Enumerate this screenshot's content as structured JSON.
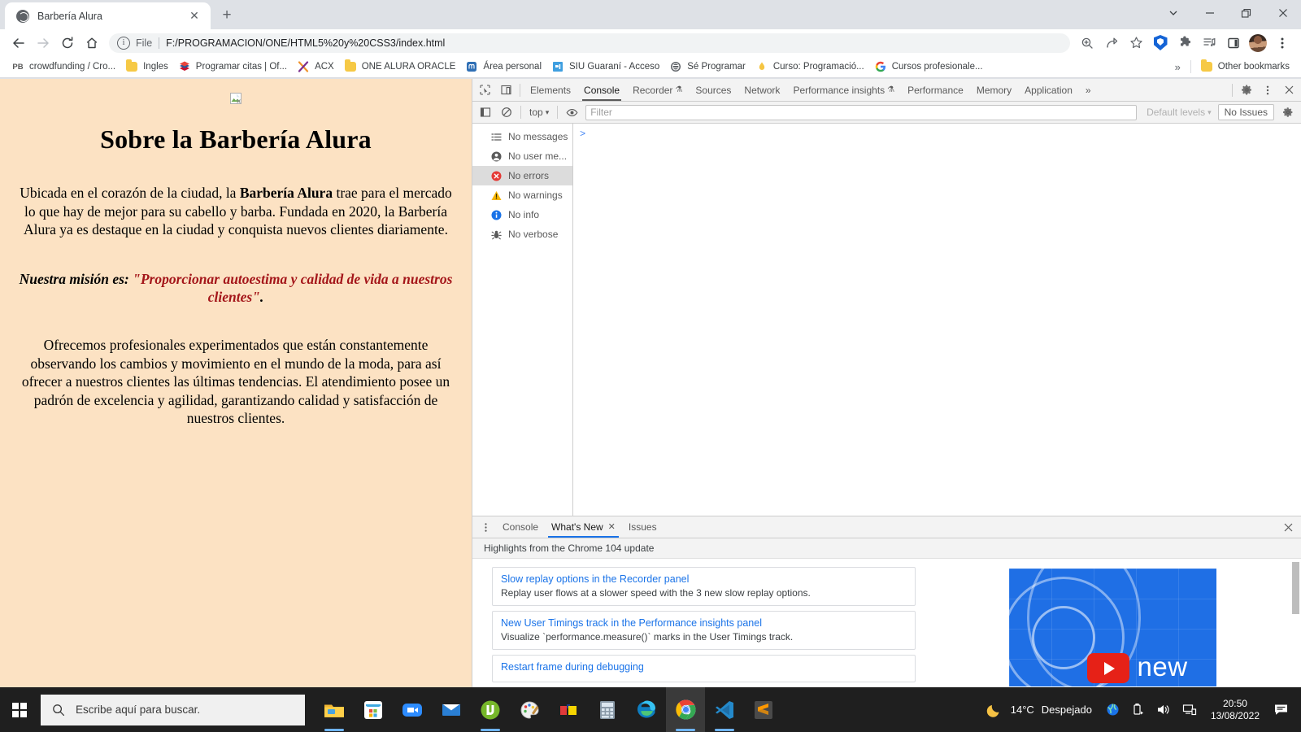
{
  "browser": {
    "tab": {
      "title": "Barbería Alura",
      "favicon": "globe-icon",
      "close": "✕"
    },
    "new_tab_label": "+",
    "window_controls": {
      "tab_search": "⌄",
      "minimize": "—",
      "maximize": "❐",
      "close": "✕"
    },
    "nav": {
      "back": "←",
      "forward": "→",
      "reload": "⟳",
      "home": "⌂"
    },
    "omnibox": {
      "info_icon": "info-icon",
      "scheme_label": "File",
      "url": "F:/PROGRAMACION/ONE/HTML5%20y%20CSS3/index.html"
    },
    "toolbar_right": [
      {
        "name": "zoom-icon",
        "glyph": "⊕"
      },
      {
        "name": "share-icon",
        "glyph": "↗"
      },
      {
        "name": "bookmark-star-icon",
        "glyph": "☆"
      },
      {
        "name": "brave-shield-extension-icon",
        "glyph": ""
      },
      {
        "name": "extensions-puzzle-icon",
        "glyph": "🧩"
      },
      {
        "name": "reading-list-icon",
        "glyph": "≡♪"
      },
      {
        "name": "side-panel-icon",
        "glyph": "▯"
      },
      {
        "name": "profile-avatar",
        "glyph": ""
      },
      {
        "name": "chrome-menu-icon",
        "glyph": "⋮"
      }
    ],
    "bookmarks": [
      {
        "label": "crowdfunding / Cro...",
        "icon": "pb-icon"
      },
      {
        "label": "Ingles",
        "icon": "folder-icon"
      },
      {
        "label": "Programar citas | Of...",
        "icon": "outlook-icon"
      },
      {
        "label": "ACX",
        "icon": "acx-icon"
      },
      {
        "label": "ONE ALURA ORACLE",
        "icon": "folder-icon"
      },
      {
        "label": "Área personal",
        "icon": "moodle-icon"
      },
      {
        "label": "SIU Guaraní - Acceso",
        "icon": "siu-icon"
      },
      {
        "label": "Sé Programar",
        "icon": "globe-icon"
      },
      {
        "label": "Curso: Programació...",
        "icon": "drop-icon"
      },
      {
        "label": "Cursos profesionale...",
        "icon": "google-icon"
      }
    ],
    "bookmarks_overflow": "»",
    "other_bookmarks": {
      "label": "Other bookmarks",
      "icon": "folder-icon"
    }
  },
  "page": {
    "broken_image_alt": "broken-image-icon",
    "heading": "Sobre la Barbería Alura",
    "paragraph1_pre": "Ubicada en el corazón de la ciudad, la ",
    "paragraph1_bold": "Barbería Alura",
    "paragraph1_post": " trae para el mercado lo que hay de mejor para su cabello y barba. Fundada en 2020, la Barbería Alura ya es destaque en la ciudad y conquista nuevos clientes diariamente.",
    "mission_label": "Nuestra misión es: ",
    "mission_quote": "\"Proporcionar autoestima y calidad de vida a nuestros clientes\"",
    "mission_period": ".",
    "paragraph3": "Ofrecemos profesionales experimentados que están constantemente observando los cambios y movimiento en el mundo de la moda, para así ofrecer a nuestros clientes las últimas tendencias. El atendimiento posee un padrón de excelencia y agilidad, garantizando calidad y satisfacción de nuestros clientes.",
    "background_color": "#fce2c3",
    "quote_color": "#a4161a"
  },
  "devtools": {
    "inspect_icon": "inspect-element-icon",
    "device_icon": "device-toolbar-icon",
    "tabs": [
      {
        "label": "Elements",
        "active": false
      },
      {
        "label": "Console",
        "active": true
      },
      {
        "label": "Recorder",
        "active": false,
        "badge": "experiment-icon"
      },
      {
        "label": "Sources",
        "active": false
      },
      {
        "label": "Network",
        "active": false
      },
      {
        "label": "Performance insights",
        "active": false,
        "badge": "experiment-icon"
      },
      {
        "label": "Performance",
        "active": false
      },
      {
        "label": "Memory",
        "active": false
      },
      {
        "label": "Application",
        "active": false
      }
    ],
    "tabs_overflow": "»",
    "settings_icon": "gear-icon",
    "more_icon": "kebab-menu-icon",
    "close_icon": "close-icon",
    "filter_bar": {
      "sidebar_toggle_icon": "console-sidebar-toggle-icon",
      "clear_icon": "clear-console-icon",
      "context": "top",
      "context_caret": "▾",
      "eye_icon": "live-expression-icon",
      "filter_placeholder": "Filter",
      "filter_value": "",
      "levels_label": "Default levels",
      "levels_caret": "▾",
      "issues_label": "No Issues",
      "settings_icon": "gear-icon"
    },
    "console_sidebar": [
      {
        "label": "No messages",
        "icon": "list-icon",
        "selected": false
      },
      {
        "label": "No user me...",
        "icon": "user-icon",
        "selected": false
      },
      {
        "label": "No errors",
        "icon": "error-icon",
        "selected": true
      },
      {
        "label": "No warnings",
        "icon": "warning-icon",
        "selected": false
      },
      {
        "label": "No info",
        "icon": "info-icon",
        "selected": false
      },
      {
        "label": "No verbose",
        "icon": "bug-icon",
        "selected": false
      }
    ],
    "console_prompt": ">",
    "drawer": {
      "menu_icon": "kebab-menu-icon",
      "tabs": [
        {
          "label": "Console",
          "active": false,
          "closable": false
        },
        {
          "label": "What's New",
          "active": true,
          "closable": true,
          "close": "✕"
        },
        {
          "label": "Issues",
          "active": false,
          "closable": false
        }
      ],
      "close_icon": "✕",
      "header": "Highlights from the Chrome 104 update",
      "cards": [
        {
          "title": "Slow replay options in the Recorder panel",
          "desc": "Replay user flows at a slower speed with the 3 new slow replay options."
        },
        {
          "title": "New User Timings track in the Performance insights panel",
          "desc": "Visualize `performance.measure()` marks in the User Timings track."
        },
        {
          "title": "Restart frame during debugging",
          "desc": ""
        }
      ],
      "video_thumb": {
        "label": "new",
        "play_icon": "youtube-play-icon"
      }
    }
  },
  "taskbar": {
    "start_icon": "windows-logo-icon",
    "search": {
      "icon": "search-icon",
      "placeholder": "Escribe aquí para buscar."
    },
    "apps": [
      {
        "name": "file-explorer-icon",
        "running": true
      },
      {
        "name": "microsoft-store-icon",
        "running": false
      },
      {
        "name": "zoom-icon",
        "running": false
      },
      {
        "name": "mail-icon",
        "running": false
      },
      {
        "name": "utorrent-icon",
        "running": true
      },
      {
        "name": "paint-icon",
        "running": false
      },
      {
        "name": "colors-app-icon",
        "running": false
      },
      {
        "name": "calculator-icon",
        "running": false
      },
      {
        "name": "microsoft-edge-icon",
        "running": false
      },
      {
        "name": "google-chrome-icon",
        "running": true,
        "active": true
      },
      {
        "name": "vscode-icon",
        "running": true
      },
      {
        "name": "sublime-text-icon",
        "running": false
      }
    ],
    "tray": {
      "weather_icon": "moon-icon",
      "temperature": "14°C",
      "condition": "Despejado",
      "icons": [
        {
          "name": "network-globe-icon"
        },
        {
          "name": "usb-eject-icon"
        },
        {
          "name": "volume-icon"
        },
        {
          "name": "network-monitor-icon"
        }
      ],
      "time": "20:50",
      "date": "13/08/2022",
      "action_center_icon": "notifications-icon"
    }
  }
}
